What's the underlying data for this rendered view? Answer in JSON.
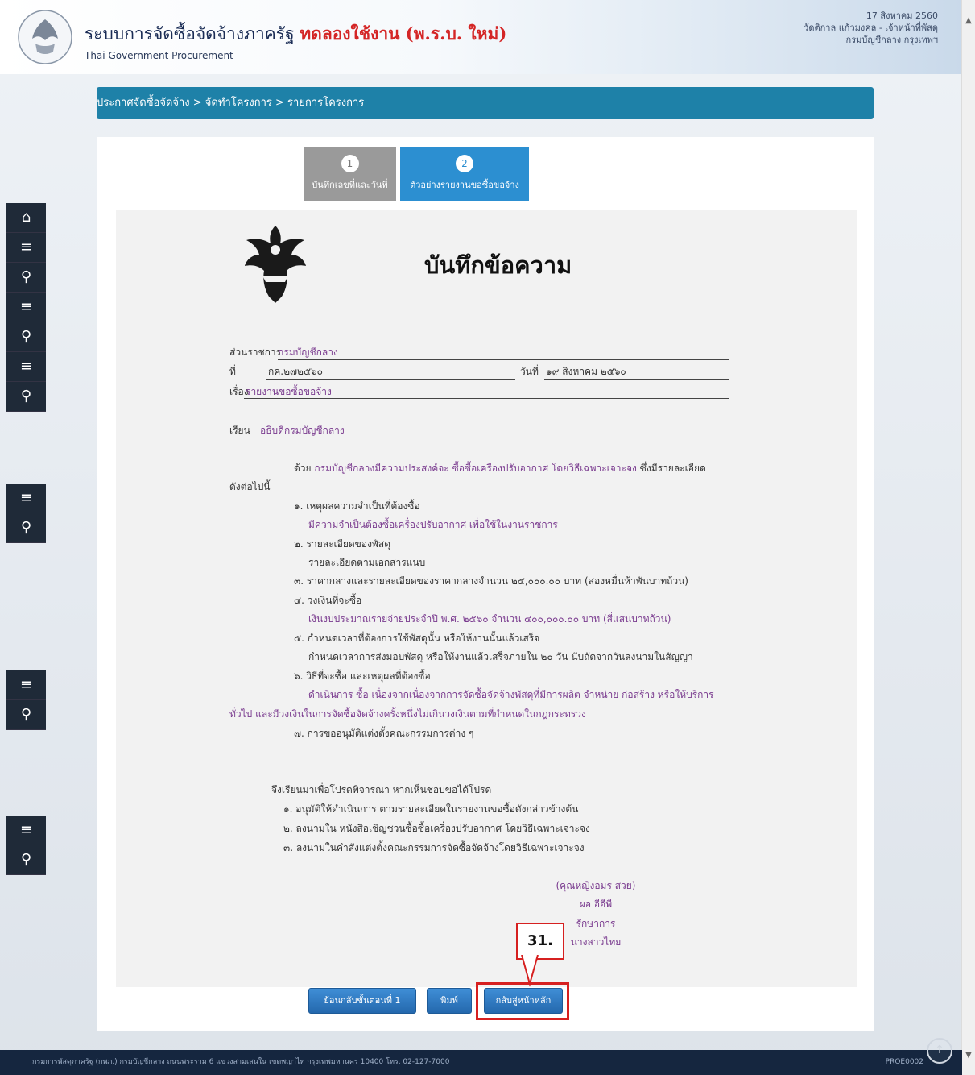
{
  "header": {
    "title_main": "ระบบการจัดซื้อจัดจ้างภาครัฐ",
    "title_test": "ทดลองใช้งาน (พ.ร.บ. ใหม่)",
    "title_en": "Thai Government Procurement",
    "date": "17 สิงหาคม 2560",
    "user": "วัดติกาล แก้วมงคล - เจ้าหน้าที่พัสดุ",
    "dept": "กรมบัญชีกลาง กรุงเทพฯ"
  },
  "breadcrumb": "ประกาศจัดซื้อจัดจ้าง > จัดทำโครงการ > รายการโครงการ",
  "steps": [
    {
      "num": "1",
      "label": "บันทึกเลขที่และวันที่"
    },
    {
      "num": "2",
      "label": "ตัวอย่างรายงานขอซื้อขอจ้าง"
    }
  ],
  "memo": {
    "title": "บันทึกข้อความ",
    "agency_label": "ส่วนราชการ",
    "agency_value": "กรมบัญชีกลาง",
    "no_label": "ที่",
    "no_value": "กค.๒๗๒๕๖๐",
    "date_label": "วันที่",
    "date_value": "๑๙ สิงหาคม ๒๕๖๐",
    "subject_label": "เรื่อง",
    "subject_value": "รายงานขอซื้อขอจ้าง",
    "to_label": "เรียน",
    "to_value": "อธิบดีกรมบัญชีกลาง",
    "intro_a": "ด้วย",
    "intro_b": "กรมบัญชีกลางมีความประสงค์จะ",
    "intro_c": "ซื้อซื้อเครื่องปรับอากาศ โดยวิธีเฉพาะเจาะจง",
    "intro_d": "ซึ่งมีรายละเอียด",
    "intro_e": "ดังต่อไปนี้",
    "item1_label": "๑. เหตุผลความจำเป็นที่ต้องซื้อ",
    "item1_value": "มีความจำเป็นต้องซื้อเครื่องปรับอากาศ เพื่อใช้ในงานราชการ",
    "item2_label": "๒. รายละเอียดของพัสดุ",
    "item2_value": "รายละเอียดตามเอกสารแนบ",
    "item3": "๓. ราคากลางและรายละเอียดของราคากลางจำนวน ๒๕,๐๐๐.๐๐ บาท (สองหมื่นห้าพันบาทถ้วน)",
    "item4_label": "๔. วงเงินที่จะซื้อ",
    "item4_value": "เงินงบประมาณรายจ่ายประจำปี พ.ศ. ๒๕๖๐ จำนวน ๔๐๐,๐๐๐.๐๐ บาท (สี่แสนบาทถ้วน)",
    "item5_label": "๕. กำหนดเวลาที่ต้องการใช้พัสดุนั้น หรือให้งานนั้นแล้วเสร็จ",
    "item5_value": "กำหนดเวลาการส่งมอบพัสดุ หรือให้งานแล้วเสร็จภายใน ๒๐ วัน นับถัดจากวันลงนามในสัญญา",
    "item6_label": "๖. วิธีที่จะซื้อ และเหตุผลที่ต้องซื้อ",
    "item6_value_a": "ดำเนินการ ซื้อ เนื่องจากเนื่องจากการจัดซื้อจัดจ้างพัสดุที่มีการผลิต จำหน่าย ก่อสร้าง หรือให้บริการ",
    "item6_value_b": "ทั่วไป และมีวงเงินในการจัดซื้อจัดจ้างครั้งหนึ่งไม่เกินวงเงินตามที่กำหนดในกฎกระทรวง",
    "item7": "๗. การขออนุมัติแต่งตั้งคณะกรรมการต่าง ๆ",
    "closing": "จึงเรียนมาเพื่อโปรดพิจารณา หากเห็นชอบขอได้โปรด",
    "close1": "๑. อนุมัติให้ดำเนินการ ตามรายละเอียดในรายงานขอซื้อดังกล่าวข้างต้น",
    "close2": "๒. ลงนามใน หนังสือเชิญชวนซื้อซื้อเครื่องปรับอากาศ โดยวิธีเฉพาะเจาะจง",
    "close3": "๓. ลงนามในคำสั่งแต่งตั้งคณะกรรมการจัดซื้อจัดจ้างโดยวิธีเฉพาะเจาะจง",
    "sig_name": "(คุณหญิงอมร สวย)",
    "sig_pos1": "ผอ อีอีพี",
    "sig_pos2": "รักษาการ",
    "sig_pos3": "นางสาวไทย"
  },
  "buttons": {
    "back": "ย้อนกลับขั้นตอนที่ 1",
    "print": "พิมพ์",
    "home": "กลับสู่หน้าหลัก"
  },
  "callout": "31.",
  "footer": {
    "text": "กรมการพัสดุภาครัฐ (กพภ.) กรมบัญชีกลาง ถนนพระราม 6 แขวงสามเสนใน เขตพญาไท กรุงเทพมหานคร 10400 โทร. 02-127-7000",
    "code": "PROE0002"
  },
  "colors": {
    "breadcrumb": "#1e81a8",
    "accent_red": "#d62020",
    "value_purple": "#7a3b8f",
    "footer_bg": "#15263f"
  }
}
